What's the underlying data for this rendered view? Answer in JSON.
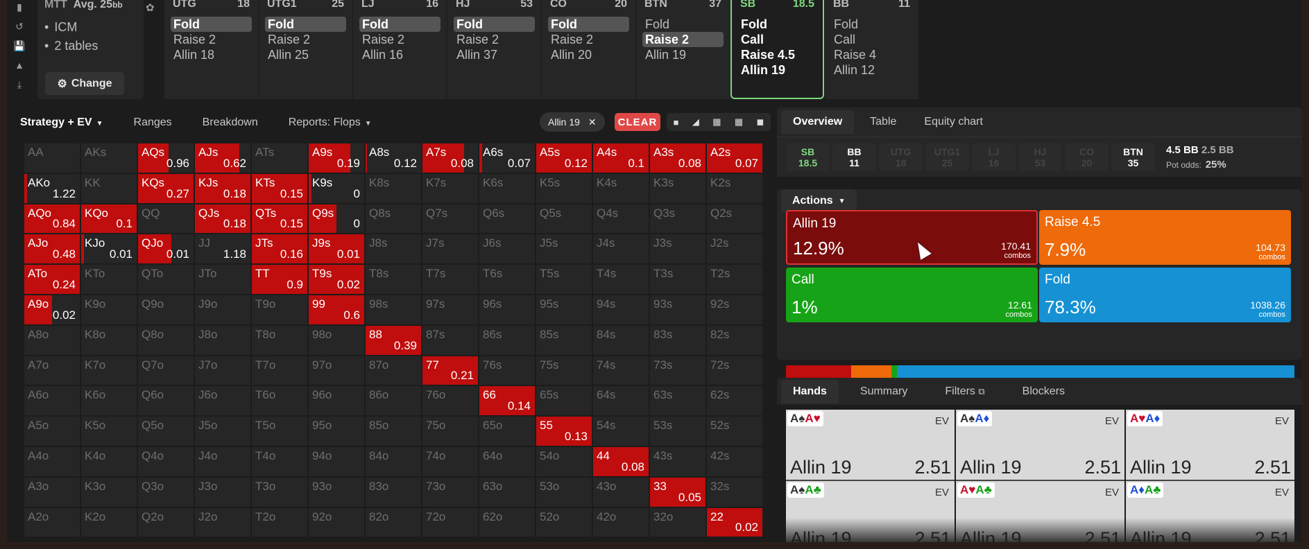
{
  "toolbar": {
    "icons": [
      "bookmark-icon",
      "history-icon",
      "save-icon",
      "gamepad-icon",
      "download-icon"
    ]
  },
  "info": {
    "game": "MTT",
    "avg_label": "Avg. 25",
    "avg_unit": "bb",
    "items": [
      "ICM",
      "2 tables"
    ],
    "change_label": "Change"
  },
  "positions": [
    {
      "name": "UTG",
      "stack": "18",
      "actions": [
        "Fold",
        "Raise 2",
        "Allin 18"
      ],
      "selected": 0
    },
    {
      "name": "UTG1",
      "stack": "25",
      "actions": [
        "Fold",
        "Raise 2",
        "Allin 25"
      ],
      "selected": 0
    },
    {
      "name": "LJ",
      "stack": "16",
      "actions": [
        "Fold",
        "Raise 2",
        "Allin 16"
      ],
      "selected": 0
    },
    {
      "name": "HJ",
      "stack": "53",
      "actions": [
        "Fold",
        "Raise 2",
        "Allin 37"
      ],
      "selected": 0
    },
    {
      "name": "CO",
      "stack": "20",
      "actions": [
        "Fold",
        "Raise 2",
        "Allin 20"
      ],
      "selected": 0
    },
    {
      "name": "BTN",
      "stack": "37",
      "actions": [
        "Fold",
        "Raise 2",
        "Allin 19"
      ],
      "selected": 1
    },
    {
      "name": "SB",
      "stack": "18.5",
      "actions": [
        "Fold",
        "Call",
        "Raise 4.5",
        "Allin 19"
      ],
      "selected": -1,
      "active": true
    },
    {
      "name": "BB",
      "stack": "11",
      "actions": [
        "Fold",
        "Call",
        "Raise 4",
        "Allin 12"
      ],
      "selected": -1
    }
  ],
  "grid_tabs": {
    "strategy": "Strategy + EV",
    "ranges": "Ranges",
    "breakdown": "Breakdown",
    "reports": "Reports: Flops"
  },
  "filter_chip": "Allin 19",
  "clear_label": "CLEAR",
  "grid": [
    [
      [
        "AA",
        0,
        ""
      ],
      [
        "AKs",
        0,
        ""
      ],
      [
        "AQs",
        0.55,
        "0.96"
      ],
      [
        "AJs",
        0.8,
        "0.62"
      ],
      [
        "ATs",
        0,
        ""
      ],
      [
        "A9s",
        0.75,
        "0.19"
      ],
      [
        "A8s",
        0.03,
        "0.12"
      ],
      [
        "A7s",
        0.75,
        "0.08"
      ],
      [
        "A6s",
        0.05,
        "0.07"
      ],
      [
        "A5s",
        1,
        "0.12"
      ],
      [
        "A4s",
        1,
        "0.1"
      ],
      [
        "A3s",
        1,
        "0.08"
      ],
      [
        "A2s",
        1,
        "0.07"
      ]
    ],
    [
      [
        "AKo",
        0.05,
        "1.22"
      ],
      [
        "KK",
        0,
        ""
      ],
      [
        "KQs",
        1,
        "0.27"
      ],
      [
        "KJs",
        1,
        "0.18"
      ],
      [
        "KTs",
        1,
        "0.15"
      ],
      [
        "K9s",
        0.05,
        "0"
      ],
      [
        "K8s",
        0,
        ""
      ],
      [
        "K7s",
        0,
        ""
      ],
      [
        "K6s",
        0,
        ""
      ],
      [
        "K5s",
        0,
        ""
      ],
      [
        "K4s",
        0,
        ""
      ],
      [
        "K3s",
        0,
        ""
      ],
      [
        "K2s",
        0,
        ""
      ]
    ],
    [
      [
        "AQo",
        1,
        "0.84"
      ],
      [
        "KQo",
        1,
        "0.1"
      ],
      [
        "QQ",
        0,
        ""
      ],
      [
        "QJs",
        1,
        "0.18"
      ],
      [
        "QTs",
        1,
        "0.15"
      ],
      [
        "Q9s",
        0.5,
        "0"
      ],
      [
        "Q8s",
        0,
        ""
      ],
      [
        "Q7s",
        0,
        ""
      ],
      [
        "Q6s",
        0,
        ""
      ],
      [
        "Q5s",
        0,
        ""
      ],
      [
        "Q4s",
        0,
        ""
      ],
      [
        "Q3s",
        0,
        ""
      ],
      [
        "Q2s",
        0,
        ""
      ]
    ],
    [
      [
        "AJo",
        1,
        "0.48"
      ],
      [
        "KJo",
        0.05,
        "0.01"
      ],
      [
        "QJo",
        0.6,
        "0.01"
      ],
      [
        "JJ",
        0,
        "1.18"
      ],
      [
        "JTs",
        1,
        "0.16"
      ],
      [
        "J9s",
        1,
        "0.01"
      ],
      [
        "J8s",
        0,
        ""
      ],
      [
        "J7s",
        0,
        ""
      ],
      [
        "J6s",
        0,
        ""
      ],
      [
        "J5s",
        0,
        ""
      ],
      [
        "J4s",
        0,
        ""
      ],
      [
        "J3s",
        0,
        ""
      ],
      [
        "J2s",
        0,
        ""
      ]
    ],
    [
      [
        "ATo",
        1,
        "0.24"
      ],
      [
        "KTo",
        0,
        ""
      ],
      [
        "QTo",
        0,
        ""
      ],
      [
        "JTo",
        0,
        ""
      ],
      [
        "TT",
        1,
        "0.9"
      ],
      [
        "T9s",
        1,
        "0.02"
      ],
      [
        "T8s",
        0,
        ""
      ],
      [
        "T7s",
        0,
        ""
      ],
      [
        "T6s",
        0,
        ""
      ],
      [
        "T5s",
        0,
        ""
      ],
      [
        "T4s",
        0,
        ""
      ],
      [
        "T3s",
        0,
        ""
      ],
      [
        "T2s",
        0,
        ""
      ]
    ],
    [
      [
        "A9o",
        0.5,
        "0.02"
      ],
      [
        "K9o",
        0,
        ""
      ],
      [
        "Q9o",
        0,
        ""
      ],
      [
        "J9o",
        0,
        ""
      ],
      [
        "T9o",
        0,
        ""
      ],
      [
        "99",
        1,
        "0.6"
      ],
      [
        "98s",
        0,
        ""
      ],
      [
        "97s",
        0,
        ""
      ],
      [
        "96s",
        0,
        ""
      ],
      [
        "95s",
        0,
        ""
      ],
      [
        "94s",
        0,
        ""
      ],
      [
        "93s",
        0,
        ""
      ],
      [
        "92s",
        0,
        ""
      ]
    ],
    [
      [
        "A8o",
        0,
        ""
      ],
      [
        "K8o",
        0,
        ""
      ],
      [
        "Q8o",
        0,
        ""
      ],
      [
        "J8o",
        0,
        ""
      ],
      [
        "T8o",
        0,
        ""
      ],
      [
        "98o",
        0,
        ""
      ],
      [
        "88",
        1,
        "0.39"
      ],
      [
        "87s",
        0,
        ""
      ],
      [
        "86s",
        0,
        ""
      ],
      [
        "85s",
        0,
        ""
      ],
      [
        "84s",
        0,
        ""
      ],
      [
        "83s",
        0,
        ""
      ],
      [
        "82s",
        0,
        ""
      ]
    ],
    [
      [
        "A7o",
        0,
        ""
      ],
      [
        "K7o",
        0,
        ""
      ],
      [
        "Q7o",
        0,
        ""
      ],
      [
        "J7o",
        0,
        ""
      ],
      [
        "T7o",
        0,
        ""
      ],
      [
        "97o",
        0,
        ""
      ],
      [
        "87o",
        0,
        ""
      ],
      [
        "77",
        1,
        "0.21"
      ],
      [
        "76s",
        0,
        ""
      ],
      [
        "75s",
        0,
        ""
      ],
      [
        "74s",
        0,
        ""
      ],
      [
        "73s",
        0,
        ""
      ],
      [
        "72s",
        0,
        ""
      ]
    ],
    [
      [
        "A6o",
        0,
        ""
      ],
      [
        "K6o",
        0,
        ""
      ],
      [
        "Q6o",
        0,
        ""
      ],
      [
        "J6o",
        0,
        ""
      ],
      [
        "T6o",
        0,
        ""
      ],
      [
        "96o",
        0,
        ""
      ],
      [
        "86o",
        0,
        ""
      ],
      [
        "76o",
        0,
        ""
      ],
      [
        "66",
        1,
        "0.14"
      ],
      [
        "65s",
        0,
        ""
      ],
      [
        "64s",
        0,
        ""
      ],
      [
        "63s",
        0,
        ""
      ],
      [
        "62s",
        0,
        ""
      ]
    ],
    [
      [
        "A5o",
        0,
        ""
      ],
      [
        "K5o",
        0,
        ""
      ],
      [
        "Q5o",
        0,
        ""
      ],
      [
        "J5o",
        0,
        ""
      ],
      [
        "T5o",
        0,
        ""
      ],
      [
        "95o",
        0,
        ""
      ],
      [
        "85o",
        0,
        ""
      ],
      [
        "75o",
        0,
        ""
      ],
      [
        "65o",
        0,
        ""
      ],
      [
        "55",
        1,
        "0.13"
      ],
      [
        "54s",
        0,
        ""
      ],
      [
        "53s",
        0,
        ""
      ],
      [
        "52s",
        0,
        ""
      ]
    ],
    [
      [
        "A4o",
        0,
        ""
      ],
      [
        "K4o",
        0,
        ""
      ],
      [
        "Q4o",
        0,
        ""
      ],
      [
        "J4o",
        0,
        ""
      ],
      [
        "T4o",
        0,
        ""
      ],
      [
        "94o",
        0,
        ""
      ],
      [
        "84o",
        0,
        ""
      ],
      [
        "74o",
        0,
        ""
      ],
      [
        "64o",
        0,
        ""
      ],
      [
        "54o",
        0,
        ""
      ],
      [
        "44",
        1,
        "0.08"
      ],
      [
        "43s",
        0,
        ""
      ],
      [
        "42s",
        0,
        ""
      ]
    ],
    [
      [
        "A3o",
        0,
        ""
      ],
      [
        "K3o",
        0,
        ""
      ],
      [
        "Q3o",
        0,
        ""
      ],
      [
        "J3o",
        0,
        ""
      ],
      [
        "T3o",
        0,
        ""
      ],
      [
        "93o",
        0,
        ""
      ],
      [
        "83o",
        0,
        ""
      ],
      [
        "73o",
        0,
        ""
      ],
      [
        "63o",
        0,
        ""
      ],
      [
        "53o",
        0,
        ""
      ],
      [
        "43o",
        0,
        ""
      ],
      [
        "33",
        1,
        "0.05"
      ],
      [
        "32s",
        0,
        ""
      ]
    ],
    [
      [
        "A2o",
        0,
        ""
      ],
      [
        "K2o",
        0,
        ""
      ],
      [
        "Q2o",
        0,
        ""
      ],
      [
        "J2o",
        0,
        ""
      ],
      [
        "T2o",
        0,
        ""
      ],
      [
        "92o",
        0,
        ""
      ],
      [
        "82o",
        0,
        ""
      ],
      [
        "72o",
        0,
        ""
      ],
      [
        "62o",
        0,
        ""
      ],
      [
        "52o",
        0,
        ""
      ],
      [
        "42o",
        0,
        ""
      ],
      [
        "32o",
        0,
        ""
      ],
      [
        "22",
        1,
        "0.02"
      ]
    ]
  ],
  "overview_tabs": [
    "Overview",
    "Table",
    "Equity chart"
  ],
  "stacks": [
    {
      "pos": "SB",
      "stack": "18.5",
      "state": "sb"
    },
    {
      "pos": "BB",
      "stack": "11",
      "state": "lit"
    },
    {
      "pos": "UTG",
      "stack": "18",
      "state": "dim"
    },
    {
      "pos": "UTG1",
      "stack": "25",
      "state": "dim"
    },
    {
      "pos": "LJ",
      "stack": "16",
      "state": "dim"
    },
    {
      "pos": "HJ",
      "stack": "53",
      "state": "dim"
    },
    {
      "pos": "CO",
      "stack": "20",
      "state": "dim"
    },
    {
      "pos": "BTN",
      "stack": "35",
      "state": "lit"
    }
  ],
  "pot": {
    "bb": "4.5 BB",
    "secondary": "2.5 BB",
    "odds_label": "Pot odds:",
    "odds_value": "25%"
  },
  "actions_label": "Actions",
  "action_boxes": [
    {
      "name": "Allin 19",
      "pct": "12.9%",
      "combos": "170.41",
      "combos_label": "combos",
      "color": "#7a0c0c",
      "freq": 12.9
    },
    {
      "name": "Raise 4.5",
      "pct": "7.9%",
      "combos": "104.73",
      "combos_label": "combos",
      "color": "#ee6a0a",
      "freq": 7.9
    },
    {
      "name": "Call",
      "pct": "1%",
      "combos": "12.61",
      "combos_label": "combos",
      "color": "#17a317",
      "freq": 1
    },
    {
      "name": "Fold",
      "pct": "78.3%",
      "combos": "1038.26",
      "combos_label": "combos",
      "color": "#1591d4",
      "freq": 78.3
    }
  ],
  "bar_colors": [
    "#c00d0d",
    "#ee6a0a",
    "#17a317",
    "#1591d4"
  ],
  "hands_tabs": [
    "Hands",
    "Summary",
    "Filters",
    "Blockers"
  ],
  "hands": [
    {
      "cards": [
        [
          "A",
          "♠",
          "s"
        ],
        [
          "A",
          "♥",
          "h"
        ]
      ],
      "ev_label": "EV",
      "action": "Allin 19",
      "ev": "2.51"
    },
    {
      "cards": [
        [
          "A",
          "♠",
          "s"
        ],
        [
          "A",
          "♦",
          "d"
        ]
      ],
      "ev_label": "EV",
      "action": "Allin 19",
      "ev": "2.51"
    },
    {
      "cards": [
        [
          "A",
          "♥",
          "h"
        ],
        [
          "A",
          "♦",
          "d"
        ]
      ],
      "ev_label": "EV",
      "action": "Allin 19",
      "ev": "2.51"
    },
    {
      "cards": [
        [
          "A",
          "♠",
          "s"
        ],
        [
          "A",
          "♣",
          "c"
        ]
      ],
      "ev_label": "EV",
      "action": "Allin 19",
      "ev": "2.51"
    },
    {
      "cards": [
        [
          "A",
          "♥",
          "h"
        ],
        [
          "A",
          "♣",
          "c"
        ]
      ],
      "ev_label": "EV",
      "action": "Allin 19",
      "ev": "2.51"
    },
    {
      "cards": [
        [
          "A",
          "♦",
          "d"
        ],
        [
          "A",
          "♣",
          "c"
        ]
      ],
      "ev_label": "EV",
      "action": "Allin 19",
      "ev": "2.51"
    }
  ]
}
